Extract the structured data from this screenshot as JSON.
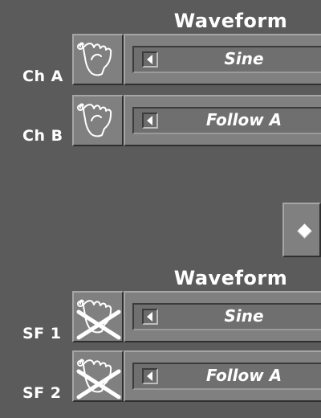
{
  "sections": [
    {
      "header": "Waveform",
      "rows": [
        {
          "label": "Ch A",
          "waveform": "Sine",
          "hand_crossed": false
        },
        {
          "label": "Ch B",
          "waveform": "Follow A",
          "hand_crossed": false
        }
      ]
    },
    {
      "header": "Waveform",
      "rows": [
        {
          "label": "SF 1",
          "waveform": "Sine",
          "hand_crossed": true
        },
        {
          "label": "SF 2",
          "waveform": "Follow A",
          "hand_crossed": true
        }
      ]
    }
  ],
  "icons": {
    "hand_normal": "hand-pointer-icon",
    "hand_crossed": "hand-pointer-crossed-icon",
    "left_arrow": "left-arrow-icon",
    "diamond": "diamond-icon"
  },
  "colors": {
    "background": "#5b5b5b",
    "button_face": "#808080",
    "text": "#ffffff"
  }
}
